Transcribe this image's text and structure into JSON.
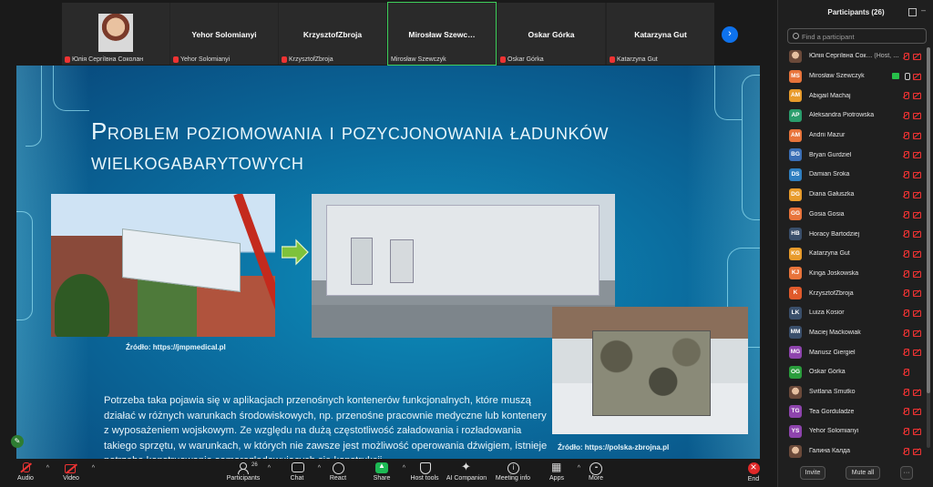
{
  "strip": {
    "tiles": [
      {
        "name": "",
        "caption": "Юлія Сергіївна Соколан",
        "muted": true
      },
      {
        "name": "Yehor Solomianyi",
        "caption": "Yehor Solomianyi",
        "muted": true
      },
      {
        "name": "KrzysztofZbroja",
        "caption": "KrzysztofZbroja",
        "muted": true
      },
      {
        "name": "Mirosław  Szewc…",
        "caption": "Mirosław Szewczyk",
        "muted": false
      },
      {
        "name": "Oskar Górka",
        "caption": "Oskar Górka",
        "muted": true
      },
      {
        "name": "Katarzyna Gut",
        "caption": "Katarzyna Gut",
        "muted": true
      }
    ]
  },
  "slide": {
    "title": "Problem poziomowania i pozycjonowania ładunków wielkogabarytowych",
    "source1": "Źródło: https://jmpmedical.pl",
    "source2": "Źródło: https://polska-zbrojna.pl",
    "body": "Potrzeba taka pojawia się w aplikacjach przenośnych kontenerów funkcjonalnych, które muszą działać w różnych warunkach środowiskowych, np. przenośne pracownie medyczne lub kontenery z wyposażeniem wojskowym. Ze względu na dużą częstotliwość załadowania i rozładowania takiego sprzętu, w warunkach, w których nie zawsze jest możliwość operowania dźwigiem, istnieje potrzeba konstruowania samorozładowujących się konstrukcji"
  },
  "toolbar": {
    "audio": "Audio",
    "video": "Video",
    "participants": "Participants",
    "participants_count": "26",
    "chat": "Chat",
    "react": "React",
    "share": "Share",
    "host_tools": "Host tools",
    "ai_companion": "AI Companion",
    "meeting_info": "Meeting info",
    "apps": "Apps",
    "more": "More",
    "end": "End"
  },
  "panel": {
    "title": "Participants (26)",
    "search_placeholder": "Find a participant",
    "invite": "Invite",
    "mute_all": "Mute all",
    "more_dots": "···",
    "participants": [
      {
        "initials": "",
        "photo": true,
        "color": "",
        "name": "Юлія Сергіївна Сок…",
        "tag": "(Host, me)",
        "state": "muted"
      },
      {
        "initials": "MS",
        "photo": false,
        "color": "#e8743b",
        "name": "Mirosław Szewczyk",
        "tag": "",
        "state": "sharing"
      },
      {
        "initials": "AM",
        "photo": false,
        "color": "#e89b2b",
        "name": "Abigail Machaj",
        "tag": "",
        "state": "muted"
      },
      {
        "initials": "AP",
        "photo": false,
        "color": "#2a9d6c",
        "name": "Aleksandra Piotrowska",
        "tag": "",
        "state": "muted"
      },
      {
        "initials": "AM",
        "photo": false,
        "color": "#e8743b",
        "name": "Andrii Mazur",
        "tag": "",
        "state": "muted"
      },
      {
        "initials": "BG",
        "photo": false,
        "color": "#3b6fb6",
        "name": "Bryan Gurdziel",
        "tag": "",
        "state": "muted"
      },
      {
        "initials": "DS",
        "photo": false,
        "color": "#2f7fc1",
        "name": "Damian Sroka",
        "tag": "",
        "state": "muted"
      },
      {
        "initials": "DG",
        "photo": false,
        "color": "#e89b2b",
        "name": "Diana Gałuszka",
        "tag": "",
        "state": "muted"
      },
      {
        "initials": "GG",
        "photo": false,
        "color": "#e8743b",
        "name": "Gosia Gosia",
        "tag": "",
        "state": "muted"
      },
      {
        "initials": "HB",
        "photo": false,
        "color": "#3a4f6b",
        "name": "Horacy Bartodziej",
        "tag": "",
        "state": "muted"
      },
      {
        "initials": "KG",
        "photo": false,
        "color": "#e89b2b",
        "name": "Katarzyna Gut",
        "tag": "",
        "state": "muted"
      },
      {
        "initials": "KJ",
        "photo": false,
        "color": "#e8743b",
        "name": "Kinga Joskowska",
        "tag": "",
        "state": "muted"
      },
      {
        "initials": "K",
        "photo": false,
        "color": "#e05a2b",
        "name": "KrzysztofZbroja",
        "tag": "",
        "state": "muted"
      },
      {
        "initials": "LK",
        "photo": false,
        "color": "#3a4f6b",
        "name": "Luiza Kosior",
        "tag": "",
        "state": "muted"
      },
      {
        "initials": "MM",
        "photo": false,
        "color": "#3a4f6b",
        "name": "Maciej Maćkowiak",
        "tag": "",
        "state": "muted"
      },
      {
        "initials": "MG",
        "photo": false,
        "color": "#8e44ad",
        "name": "Mariusz Giergiel",
        "tag": "",
        "state": "muted"
      },
      {
        "initials": "OG",
        "photo": false,
        "color": "#2a9d3c",
        "name": "Oskar Górka",
        "tag": "",
        "state": "mic-only"
      },
      {
        "initials": "",
        "photo": true,
        "color": "",
        "name": "Svitlana Smutko",
        "tag": "",
        "state": "muted"
      },
      {
        "initials": "TG",
        "photo": false,
        "color": "#8e44ad",
        "name": "Tea Gorduladze",
        "tag": "",
        "state": "muted"
      },
      {
        "initials": "YS",
        "photo": false,
        "color": "#8e44ad",
        "name": "Yehor Solomianyi",
        "tag": "",
        "state": "muted"
      },
      {
        "initials": "",
        "photo": true,
        "color": "",
        "name": "Галина Калда",
        "tag": "",
        "state": "muted"
      }
    ]
  }
}
